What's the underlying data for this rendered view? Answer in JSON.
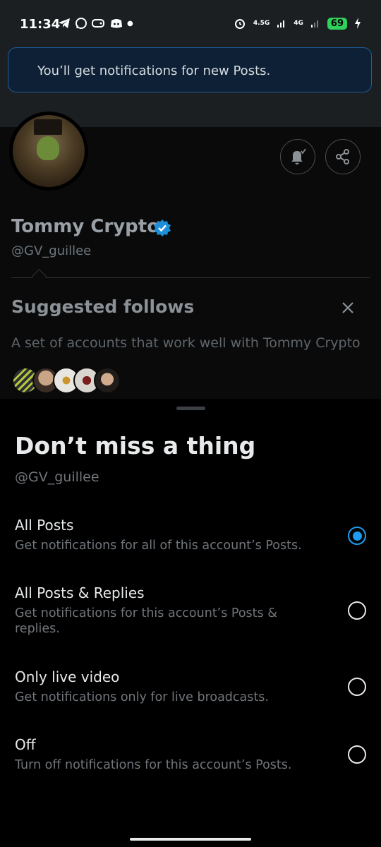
{
  "status_bar": {
    "time": "11:34",
    "left_icons": [
      "telegram-icon",
      "whatsapp-icon",
      "game-controller-icon",
      "discord-icon",
      "dot-icon"
    ],
    "network_1": "4.5G",
    "network_2": "4G",
    "battery": "69"
  },
  "toast": {
    "text": "You’ll get notifications for new Posts."
  },
  "profile": {
    "name": "Tommy Crypto",
    "handle": "@GV_guillee"
  },
  "suggested": {
    "title": "Suggested follows",
    "subtitle": "A set of accounts that work well with Tommy Crypto"
  },
  "sheet": {
    "title": "Don’t miss a thing",
    "handle": "@GV_guillee",
    "options": [
      {
        "title": "All Posts",
        "desc": "Get notifications for all of this account’s Posts.",
        "selected": true
      },
      {
        "title": "All Posts & Replies",
        "desc": "Get notifications for this account’s Posts & replies.",
        "selected": false
      },
      {
        "title": "Only live video",
        "desc": "Get notifications only for live broadcasts.",
        "selected": false
      },
      {
        "title": "Off",
        "desc": "Turn off notifications for this account’s Posts.",
        "selected": false
      }
    ]
  },
  "colors": {
    "accent": "#1d9bf0",
    "toast_bg": "#0d2035",
    "battery": "#2fd15a"
  }
}
